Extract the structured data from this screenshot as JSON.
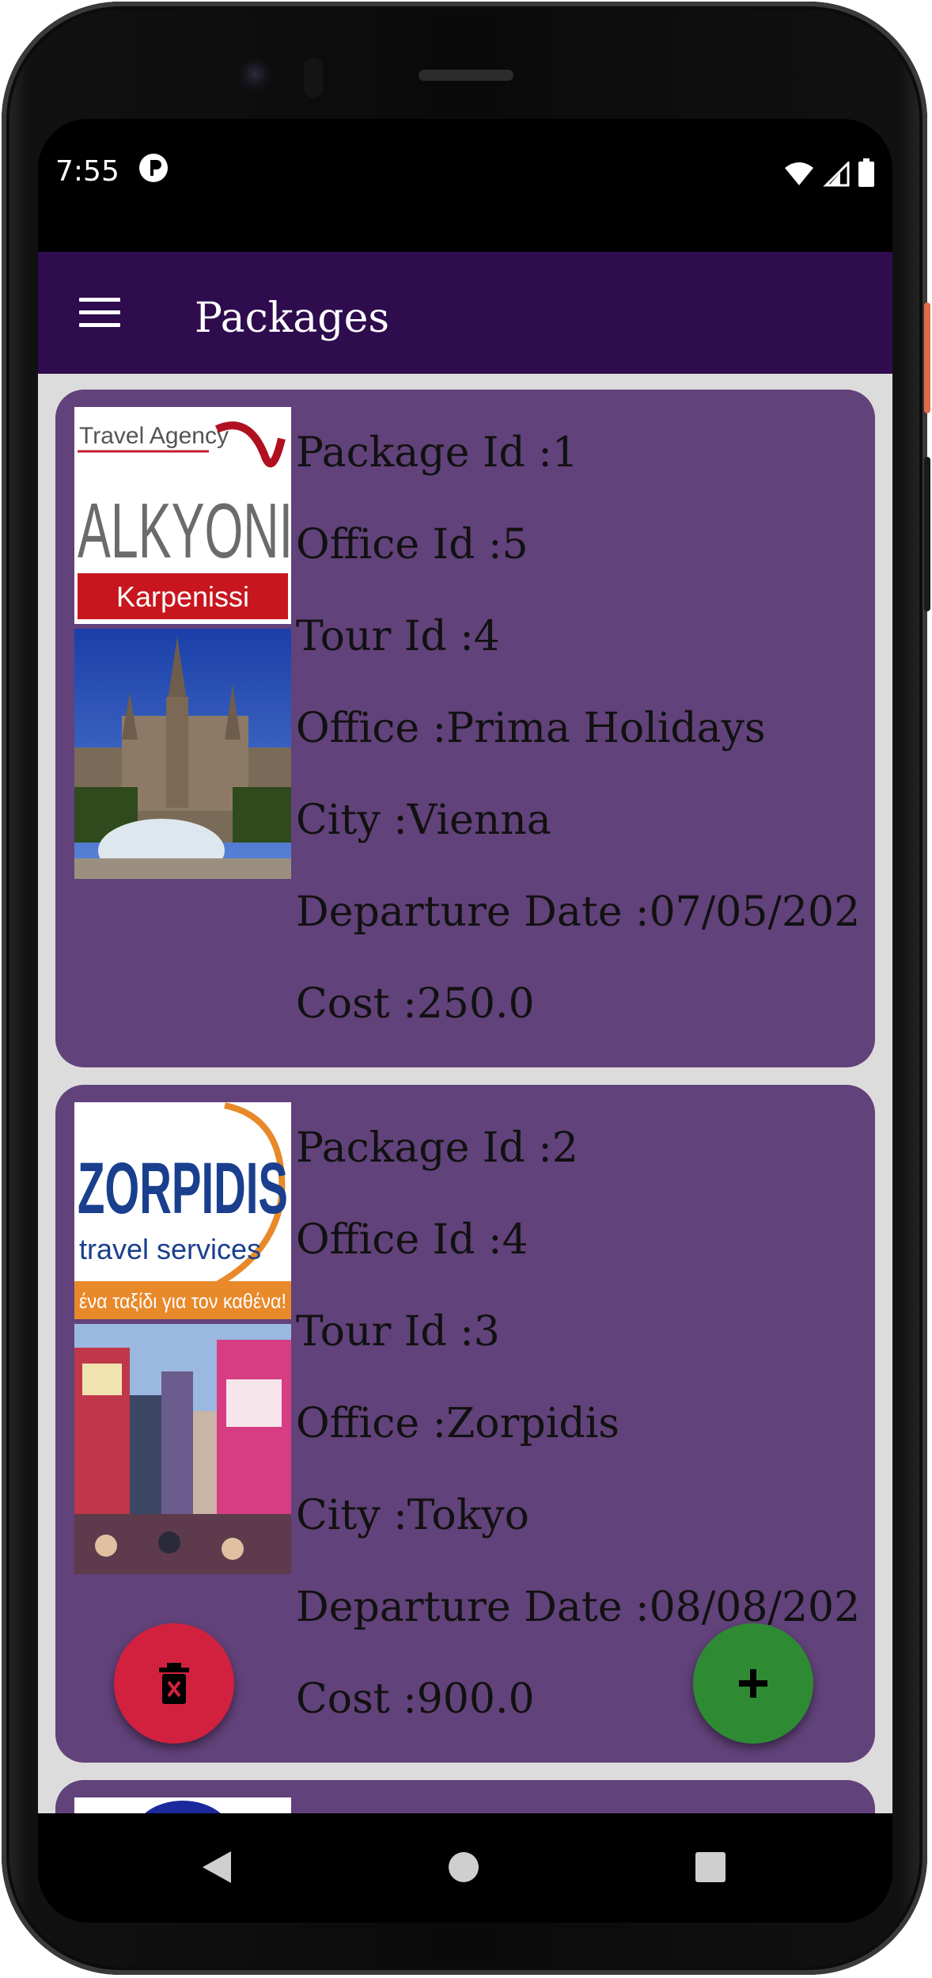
{
  "status_bar": {
    "time": "7:55",
    "icons": [
      "notification-p-icon",
      "wifi-icon",
      "signal-icon",
      "battery-icon"
    ]
  },
  "app_bar": {
    "menu_icon": "hamburger-menu-icon",
    "title": "Packages",
    "color": "#2e0c4e"
  },
  "packages": [
    {
      "package_id": "Package Id :1",
      "office_id": "Office Id :5",
      "tour_id": "Tour Id :4",
      "office": "Office :Prima Holidays",
      "city": "City :Vienna",
      "departure": "Departure Date :07/05/202",
      "cost": "Cost :250.0",
      "logo": {
        "line1": "Travel Agency",
        "brand": "ALKYONI",
        "sub": "Karpenissi"
      }
    },
    {
      "package_id": "Package Id :2",
      "office_id": "Office Id :4",
      "tour_id": "Tour Id :3",
      "office": "Office :Zorpidis",
      "city": "City :Tokyo",
      "departure": "Departure Date :08/08/202",
      "cost": "Cost :900.0",
      "logo": {
        "brand": "ZORPIDIS",
        "sub": "travel services",
        "tag": "ένα ταξίδι για τον καθένα!"
      }
    }
  ],
  "fabs": {
    "delete_icon": "trash-icon",
    "add_icon": "plus-icon",
    "delete_color": "#d2213f",
    "add_color": "#2e8b34"
  },
  "card_color": "#62427a",
  "nav_bar": [
    "back-triangle-icon",
    "home-circle-icon",
    "recents-square-icon"
  ]
}
